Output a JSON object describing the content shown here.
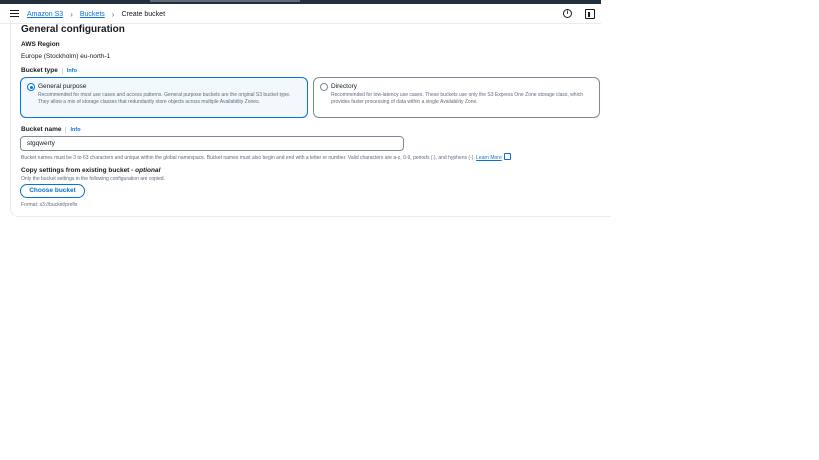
{
  "breadcrumb": {
    "items": [
      "Amazon S3",
      "Buckets",
      "Create bucket"
    ]
  },
  "header_icons": {
    "info": "i"
  },
  "section": {
    "title": "General configuration"
  },
  "region": {
    "label": "AWS Region",
    "value": "Europe (Stockholm) eu-north-1"
  },
  "bucket_type": {
    "label": "Bucket type",
    "info": "Info",
    "options": [
      {
        "title": "General purpose",
        "description": "Recommended for most use cases and access patterns. General purpose buckets are the original S3 bucket type. They allow a mix of storage classes that redundantly store objects across multiple Availability Zones.",
        "selected": true
      },
      {
        "title": "Directory",
        "description": "Recommended for low-latency use cases. These buckets use only the S3 Express One Zone storage class, which provides faster processing of data within a single Availability Zone.",
        "selected": false
      }
    ]
  },
  "bucket_name": {
    "label": "Bucket name",
    "info": "Info",
    "value": "stgqwerty",
    "hint": "Bucket names must be 3 to 63 characters and unique within the global namespace. Bucket names must also begin and end with a letter or number. Valid characters are a-z, 0-9, periods (.), and hyphens (-).",
    "learn_more": "Learn More"
  },
  "copy_settings": {
    "title": "Copy settings from existing bucket - ",
    "optional": "optional",
    "subtitle": "Only the bucket settings in the following configuration are copied.",
    "button": "Choose bucket",
    "format": "Format: s3://bucket/prefix"
  },
  "colors": {
    "accent": "#0972d3",
    "topbar": "#232f3e",
    "muted": "#5f6b7a"
  }
}
